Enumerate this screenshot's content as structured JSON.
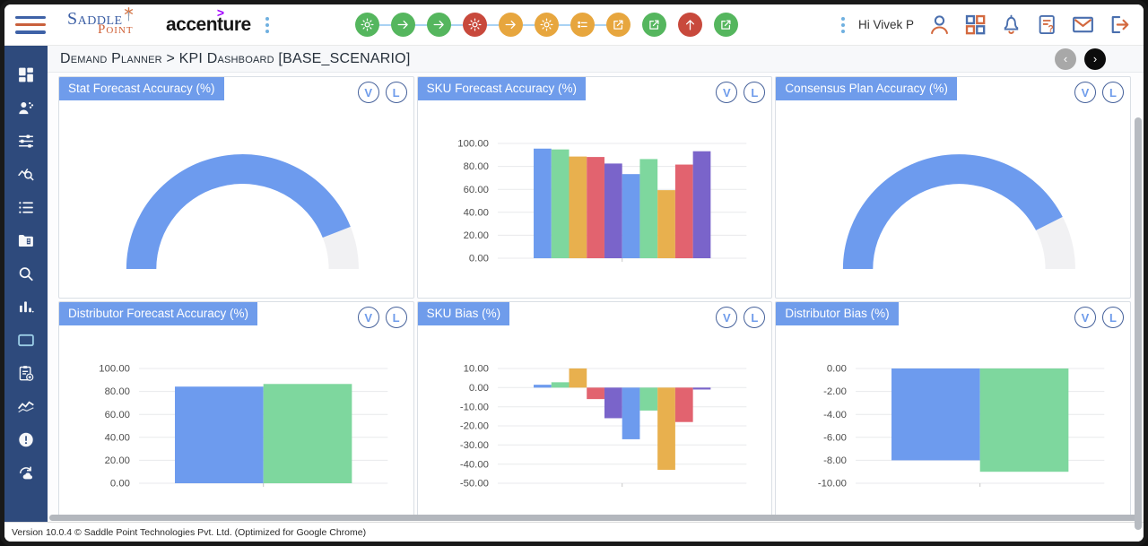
{
  "header": {
    "brand": {
      "name_top": "Saddle",
      "name_bottom": "Point",
      "partner": "accenture"
    },
    "greeting": "Hi Vivek P",
    "workflow_chain": [
      {
        "icon": "gear",
        "color": "green"
      },
      {
        "icon": "arrow-right",
        "color": "green"
      },
      {
        "icon": "arrow-right",
        "color": "green"
      },
      {
        "icon": "gear",
        "color": "red"
      },
      {
        "icon": "arrow-right",
        "color": "amber"
      },
      {
        "icon": "gear",
        "color": "amber"
      },
      {
        "icon": "form",
        "color": "amber"
      },
      {
        "icon": "export",
        "color": "amber"
      }
    ],
    "workflow_extra": [
      {
        "icon": "export",
        "color": "green"
      },
      {
        "icon": "arrow-up",
        "color": "red"
      },
      {
        "icon": "export",
        "color": "green"
      }
    ],
    "actions": [
      {
        "icon": "user"
      },
      {
        "icon": "grid"
      },
      {
        "icon": "bell"
      },
      {
        "icon": "help-doc"
      },
      {
        "icon": "mail"
      },
      {
        "icon": "logout"
      }
    ]
  },
  "sidebar": {
    "items": [
      {
        "icon": "dashboard"
      },
      {
        "icon": "users"
      },
      {
        "icon": "sliders"
      },
      {
        "icon": "chart-search"
      },
      {
        "icon": "list"
      },
      {
        "icon": "folder-doc"
      },
      {
        "icon": "search"
      },
      {
        "icon": "bar-chart"
      },
      {
        "icon": "card"
      },
      {
        "icon": "clipboard-add"
      },
      {
        "icon": "trend"
      },
      {
        "icon": "alert"
      },
      {
        "icon": "sync"
      }
    ]
  },
  "breadcrumb": {
    "text": "Demand Planner > KPI Dashboard [BASE_SCENARIO]"
  },
  "crumb_nav": {
    "prev": "‹",
    "next": "›"
  },
  "panel_buttons": {
    "v": "V",
    "l": "L"
  },
  "chart_data": [
    {
      "type": "gauge",
      "title": "Stat Forecast Accuracy (%)",
      "value_pct": 88,
      "range": [
        0,
        100
      ],
      "fill": "#6d9bee",
      "track": "#f1f1f3"
    },
    {
      "type": "bar",
      "title": "SKU Forecast Accuracy (%)",
      "values": [
        95.5,
        94.8,
        88.6,
        88.2,
        82.5,
        73.3,
        86.4,
        59.3,
        81.6,
        93.2
      ],
      "ylim": [
        0,
        100
      ],
      "yticks": [
        100,
        80,
        60,
        40,
        20,
        0
      ],
      "grid": true,
      "legend_position": "none"
    },
    {
      "type": "gauge",
      "title": "Consensus Plan Accuracy (%)",
      "value_pct": 85,
      "range": [
        0,
        100
      ],
      "fill": "#6d9bee",
      "track": "#f1f1f3"
    },
    {
      "type": "bar",
      "title": "Distributor Forecast Accuracy (%)",
      "values": [
        84.2,
        86.5
      ],
      "ylim": [
        0,
        100
      ],
      "yticks": [
        100,
        80,
        60,
        40,
        20,
        0
      ],
      "grid": true,
      "legend_position": "none"
    },
    {
      "type": "bar",
      "title": "SKU Bias (%)",
      "values": [
        1.5,
        2.8,
        10,
        -6,
        -16,
        -27,
        -12,
        -43,
        -18,
        -1
      ],
      "ylim": [
        -50,
        10
      ],
      "yticks": [
        10,
        0,
        -10,
        -20,
        -30,
        -40,
        -50
      ],
      "grid": true,
      "legend_position": "none"
    },
    {
      "type": "bar",
      "title": "Distributor Bias (%)",
      "values": [
        -8,
        -9
      ],
      "ylim": [
        -10,
        0
      ],
      "yticks": [
        0,
        -2,
        -4,
        -6,
        -8,
        -10
      ],
      "grid": true,
      "legend_position": "none"
    }
  ],
  "footer": {
    "text": "Version 10.0.4 © Saddle Point Technologies Pvt. Ltd.  (Optimized for Google Chrome)"
  },
  "colors": {
    "accent_blue": "#6d9bee",
    "palette": [
      "#6d9bee",
      "#7ed79e",
      "#e8b04e",
      "#e2636f",
      "#7a64ca"
    ],
    "gauge_track": "#f1f1f3",
    "sidebar_bg": "#2e4a7c",
    "title_chip": "#6f9ceb",
    "workflow": {
      "green": "#55b65e",
      "amber": "#e7a63e",
      "red": "#c8493c"
    },
    "connector": "#a9d2f3"
  }
}
